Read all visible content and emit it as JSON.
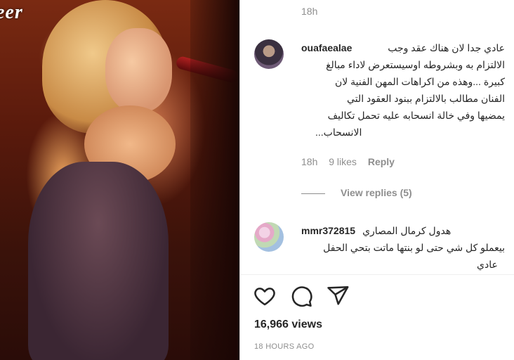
{
  "media": {
    "watermark": "eer"
  },
  "pane": {
    "top_timestamp": "18h",
    "comments": [
      {
        "username": "ouafaealae",
        "lines": [
          "عادي جدا لان هناك عقد وجب",
          "الالتزام به وبشروطه اوسيستعرض لاداء مبالغ",
          "كبيرة ...وهذه من اكراهات المهن الفنية لان",
          "الفنان مطالب بالالتزام ببنود العقود التي",
          "يمضيها وفي خالة انسحابه عليه تحمل تكاليف",
          "الانسحاب..."
        ],
        "time": "18h",
        "likes": "9 likes",
        "reply_label": "Reply",
        "view_replies": "View replies (5)"
      },
      {
        "username": "mmr372815",
        "lines": [
          "هدول كرمال المصاري",
          "بيعملو كل شي حتى لو بنتها ماتت بتحي الحفل",
          "عادي"
        ]
      }
    ],
    "actions": {
      "like_icon": "heart-icon",
      "comment_icon": "comment-icon",
      "share_icon": "paper-plane-icon"
    },
    "views": "16,966 views",
    "posted_ago": "18 HOURS AGO"
  }
}
